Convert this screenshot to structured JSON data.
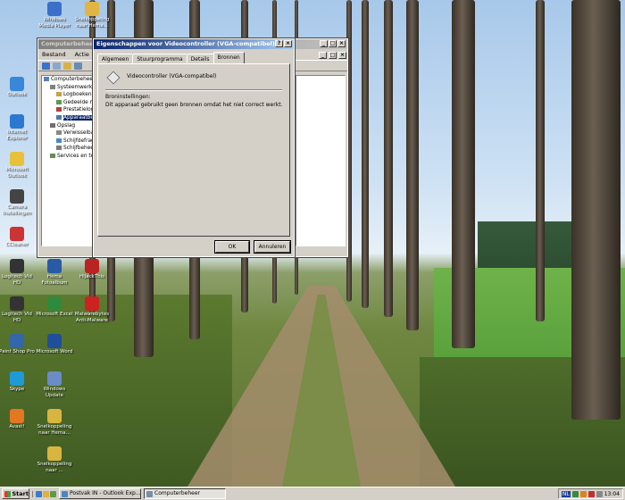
{
  "desktop": {
    "icons": [
      {
        "label": "Windows Media Player"
      },
      {
        "label": "Snelkoppeling naar Hema..."
      },
      {
        "label": "Outlook"
      },
      {
        "label": "Internet Explorer"
      },
      {
        "label": "Microsoft Outlook"
      },
      {
        "label": "Camera Instellingen"
      },
      {
        "label": "CCleaner"
      },
      {
        "label": "Logitech Vid HD"
      },
      {
        "label": "Hema Fotoalbum"
      },
      {
        "label": "HiJackThis"
      },
      {
        "label": "Logitech Vid HD"
      },
      {
        "label": "Microsoft Excel"
      },
      {
        "label": "Malwarebytes Anti-Malware"
      },
      {
        "label": "Paint Shop Pro"
      },
      {
        "label": "Microsoft Word"
      },
      {
        "label": "Skype"
      },
      {
        "label": "Windows Update"
      },
      {
        "label": "Avast!"
      },
      {
        "label": "Snelkoppeling naar Hema..."
      },
      {
        "label": "Snelkoppeling naar ..."
      }
    ]
  },
  "cb_window": {
    "title": "Computerbeheer",
    "menu": [
      "Bestand",
      "Actie"
    ],
    "tree": [
      {
        "label": "Computerbeheer (lokaal)",
        "indent": 0
      },
      {
        "label": "Systeemwerkset",
        "indent": 1
      },
      {
        "label": "Logboeken",
        "indent": 2
      },
      {
        "label": "Gedeelde mappen",
        "indent": 2
      },
      {
        "label": "Prestatielogboeken",
        "indent": 2
      },
      {
        "label": "Apparaatbeheer",
        "indent": 2,
        "selected": true
      },
      {
        "label": "Opslag",
        "indent": 1
      },
      {
        "label": "Verwisselbare opslag",
        "indent": 2
      },
      {
        "label": "Schijfdefragmentatie",
        "indent": 2
      },
      {
        "label": "Schijfbeheer",
        "indent": 2
      },
      {
        "label": "Services en toepassingen",
        "indent": 1
      }
    ]
  },
  "dialog": {
    "title": "Eigenschappen voor Videocontroller (VGA-compatibel)",
    "tabs": [
      "Algemeen",
      "Stuurprogramma",
      "Details",
      "Bronnen"
    ],
    "active_tab": "Bronnen",
    "device_name": "Videocontroller (VGA-compatibel)",
    "resources_label": "Broninstellingen:",
    "resources_message": "Dit apparaat gebruikt geen bronnen omdat het niet correct werkt.",
    "ok_label": "OK",
    "cancel_label": "Annuleren",
    "help_glyph": "?",
    "close_glyph": "×"
  },
  "taskbar": {
    "start_label": "Start",
    "tasks": [
      {
        "label": "Postvak IN - Outlook Exp...",
        "pressed": false
      },
      {
        "label": "Computerbeheer",
        "pressed": true
      }
    ],
    "tray_lang": "NL",
    "clock": "13:04"
  }
}
